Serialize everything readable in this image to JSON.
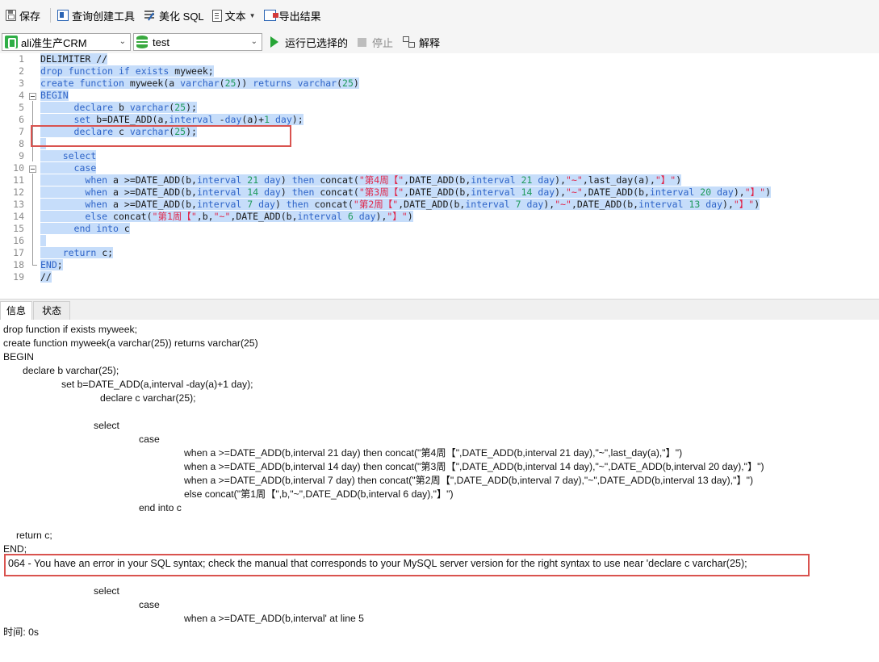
{
  "toolbar": {
    "save": "保存",
    "query_builder": "查询创建工具",
    "beautify_sql": "美化 SQL",
    "text": "文本",
    "export_results": "导出结果"
  },
  "connection_bar": {
    "connection": "ali准生产CRM",
    "database": "test",
    "run_selected": "运行已选择的",
    "stop": "停止",
    "explain": "解释"
  },
  "editor": {
    "lines": [
      "DELIMITER //",
      "drop function if exists myweek;",
      "create function myweek(a varchar(25)) returns varchar(25)",
      "BEGIN",
      "      declare b varchar(25);",
      "      set b=DATE_ADD(a,interval -day(a)+1 day);",
      "      declare c varchar(25);",
      "",
      "    select",
      "      case",
      "        when a >=DATE_ADD(b,interval 21 day) then concat(\"第4周【\",DATE_ADD(b,interval 21 day),\"~\",last_day(a),\"】\")",
      "        when a >=DATE_ADD(b,interval 14 day) then concat(\"第3周【\",DATE_ADD(b,interval 14 day),\"~\",DATE_ADD(b,interval 20 day),\"】\")",
      "        when a >=DATE_ADD(b,interval 7 day) then concat(\"第2周【\",DATE_ADD(b,interval 7 day),\"~\",DATE_ADD(b,interval 13 day),\"】\")",
      "        else concat(\"第1周【\",b,\"~\",DATE_ADD(b,interval 6 day),\"】\")",
      "      end into c",
      "",
      "    return c;",
      "END;",
      "//"
    ],
    "line_numbers": [
      "1",
      "2",
      "3",
      "4",
      "5",
      "6",
      "7",
      "8",
      "9",
      "10",
      "11",
      "12",
      "13",
      "14",
      "15",
      "16",
      "17",
      "18",
      "19"
    ]
  },
  "tabs": {
    "info": "信息",
    "status": "状态"
  },
  "messages": {
    "lines": [
      "drop function if exists myweek;",
      "create function myweek(a varchar(25)) returns varchar(25)",
      "BEGIN",
      "declare b varchar(25);",
      "set b=DATE_ADD(a,interval -day(a)+1 day);",
      "declare c varchar(25);",
      "select",
      "case",
      "when a >=DATE_ADD(b,interval 21 day) then concat(\"第4周【\",DATE_ADD(b,interval 21 day),\"~\",last_day(a),\"】\")",
      "when a >=DATE_ADD(b,interval 14 day) then concat(\"第3周【\",DATE_ADD(b,interval 14 day),\"~\",DATE_ADD(b,interval 20 day),\"】\")",
      "when a >=DATE_ADD(b,interval 7 day) then concat(\"第2周【\",DATE_ADD(b,interval 7 day),\"~\",DATE_ADD(b,interval 13 day),\"】\")",
      "else concat(\"第1周【\",b,\"~\",DATE_ADD(b,interval 6 day),\"】\")",
      "end into c",
      "return c;",
      "END;",
      "064 - You have an error in your SQL syntax; check the manual that corresponds to your MySQL server version for the right syntax to use near 'declare c varchar(25);",
      "select",
      "case",
      "when a >=DATE_ADD(b,interval' at line 5",
      "时间: 0s"
    ]
  },
  "colors": {
    "keyword": "#2e64c8",
    "number": "#1f9a5c",
    "string": "#e0264a",
    "selection": "#c6ddfa",
    "highlight_box": "#d9534f"
  }
}
